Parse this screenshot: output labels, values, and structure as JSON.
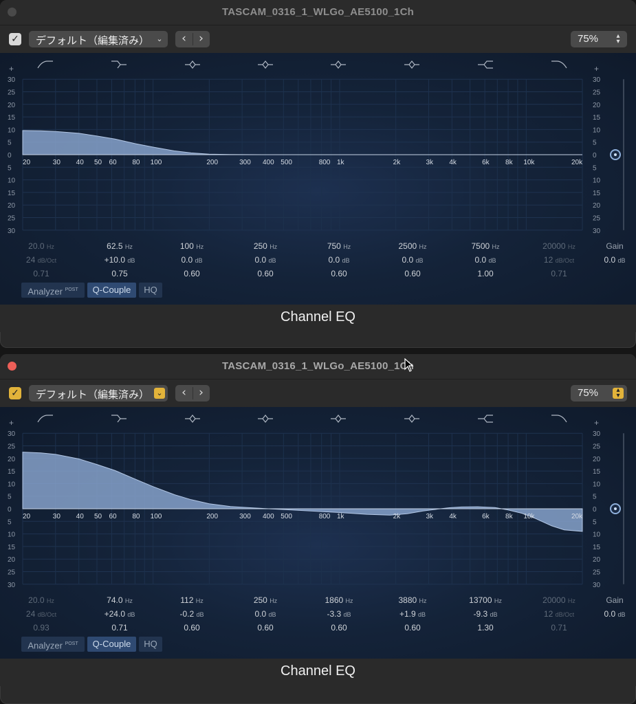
{
  "windows": [
    {
      "title": "TASCAM_0316_1_WLGo_AE5100_1Ch",
      "close_active": false,
      "preset": "デフォルト（編集済み）",
      "zoom": "75%",
      "footer": "Channel EQ",
      "bands": [
        {
          "freq": "20.0",
          "freq_unit": "Hz",
          "gain": "24",
          "gain_unit": "dB/Oct",
          "q": "0.71",
          "dim": true
        },
        {
          "freq": "62.5",
          "freq_unit": "Hz",
          "gain": "+10.0",
          "gain_unit": "dB",
          "q": "0.75",
          "dim": false
        },
        {
          "freq": "100",
          "freq_unit": "Hz",
          "gain": "0.0",
          "gain_unit": "dB",
          "q": "0.60",
          "dim": false
        },
        {
          "freq": "250",
          "freq_unit": "Hz",
          "gain": "0.0",
          "gain_unit": "dB",
          "q": "0.60",
          "dim": false
        },
        {
          "freq": "750",
          "freq_unit": "Hz",
          "gain": "0.0",
          "gain_unit": "dB",
          "q": "0.60",
          "dim": false
        },
        {
          "freq": "2500",
          "freq_unit": "Hz",
          "gain": "0.0",
          "gain_unit": "dB",
          "q": "0.60",
          "dim": false
        },
        {
          "freq": "7500",
          "freq_unit": "Hz",
          "gain": "0.0",
          "gain_unit": "dB",
          "q": "1.00",
          "dim": false
        },
        {
          "freq": "20000",
          "freq_unit": "Hz",
          "gain": "12",
          "gain_unit": "dB/Oct",
          "q": "0.71",
          "dim": true
        }
      ],
      "output_gain": {
        "label": "Gain",
        "value": "0.0",
        "unit": "dB"
      },
      "curve": [
        [
          20,
          9.6
        ],
        [
          25,
          9.5
        ],
        [
          30,
          9.2
        ],
        [
          40,
          8.5
        ],
        [
          50,
          7.4
        ],
        [
          62.5,
          6.2
        ],
        [
          80,
          4.4
        ],
        [
          100,
          3.0
        ],
        [
          130,
          1.5
        ],
        [
          160,
          0.7
        ],
        [
          200,
          0.2
        ],
        [
          260,
          0.05
        ],
        [
          400,
          0
        ],
        [
          20000,
          0
        ]
      ]
    },
    {
      "title": "TASCAM_0316_1_WLGo_AE5100_1Ch",
      "close_active": true,
      "preset": "デフォルト（編集済み）",
      "zoom": "75%",
      "footer": "Channel EQ",
      "bands": [
        {
          "freq": "20.0",
          "freq_unit": "Hz",
          "gain": "24",
          "gain_unit": "dB/Oct",
          "q": "0.93",
          "dim": true
        },
        {
          "freq": "74.0",
          "freq_unit": "Hz",
          "gain": "+24.0",
          "gain_unit": "dB",
          "q": "0.71",
          "dim": false
        },
        {
          "freq": "112",
          "freq_unit": "Hz",
          "gain": "-0.2",
          "gain_unit": "dB",
          "q": "0.60",
          "dim": false
        },
        {
          "freq": "250",
          "freq_unit": "Hz",
          "gain": "0.0",
          "gain_unit": "dB",
          "q": "0.60",
          "dim": false
        },
        {
          "freq": "1860",
          "freq_unit": "Hz",
          "gain": "-3.3",
          "gain_unit": "dB",
          "q": "0.60",
          "dim": false
        },
        {
          "freq": "3880",
          "freq_unit": "Hz",
          "gain": "+1.9",
          "gain_unit": "dB",
          "q": "0.60",
          "dim": false
        },
        {
          "freq": "13700",
          "freq_unit": "Hz",
          "gain": "-9.3",
          "gain_unit": "dB",
          "q": "1.30",
          "dim": false
        },
        {
          "freq": "20000",
          "freq_unit": "Hz",
          "gain": "12",
          "gain_unit": "dB/Oct",
          "q": "0.71",
          "dim": true
        }
      ],
      "output_gain": {
        "label": "Gain",
        "value": "0.0",
        "unit": "dB"
      },
      "curve": [
        [
          20,
          22.5
        ],
        [
          25,
          22.2
        ],
        [
          30,
          21.6
        ],
        [
          40,
          19.8
        ],
        [
          50,
          17.6
        ],
        [
          62.5,
          15.2
        ],
        [
          80,
          11.8
        ],
        [
          100,
          8.8
        ],
        [
          130,
          5.6
        ],
        [
          160,
          3.6
        ],
        [
          200,
          2.0
        ],
        [
          260,
          0.9
        ],
        [
          350,
          0.3
        ],
        [
          500,
          -0.3
        ],
        [
          700,
          -0.9
        ],
        [
          1000,
          -1.5
        ],
        [
          1400,
          -2.2
        ],
        [
          1860,
          -2.5
        ],
        [
          2300,
          -2.0
        ],
        [
          2800,
          -0.9
        ],
        [
          3300,
          -0.2
        ],
        [
          3880,
          0.4
        ],
        [
          4500,
          0.7
        ],
        [
          5500,
          0.8
        ],
        [
          6800,
          0.5
        ],
        [
          8000,
          -0.5
        ],
        [
          9500,
          -1.8
        ],
        [
          11000,
          -3.6
        ],
        [
          13700,
          -6.8
        ],
        [
          16000,
          -8.4
        ],
        [
          20000,
          -9.0
        ]
      ]
    }
  ],
  "scale_labels": [
    "30",
    "25",
    "20",
    "15",
    "10",
    "5",
    "0",
    "5",
    "10",
    "15",
    "20",
    "25",
    "30"
  ],
  "freq_ticks": [
    {
      "f": 20,
      "l": "20"
    },
    {
      "f": 30,
      "l": "30"
    },
    {
      "f": 40,
      "l": "40"
    },
    {
      "f": 50,
      "l": "50"
    },
    {
      "f": 60,
      "l": "60"
    },
    {
      "f": 80,
      "l": "80"
    },
    {
      "f": 100,
      "l": "100"
    },
    {
      "f": 200,
      "l": "200"
    },
    {
      "f": 300,
      "l": "300"
    },
    {
      "f": 400,
      "l": "400"
    },
    {
      "f": 500,
      "l": "500"
    },
    {
      "f": 800,
      "l": "800"
    },
    {
      "f": 1000,
      "l": "1k"
    },
    {
      "f": 2000,
      "l": "2k"
    },
    {
      "f": 3000,
      "l": "3k"
    },
    {
      "f": 4000,
      "l": "4k"
    },
    {
      "f": 6000,
      "l": "6k"
    },
    {
      "f": 8000,
      "l": "8k"
    },
    {
      "f": 10000,
      "l": "10k"
    },
    {
      "f": 20000,
      "l": "20k"
    }
  ],
  "buttons": {
    "analyzer": "Analyzer",
    "analyzer_sup": "POST",
    "qcouple": "Q-Couple",
    "hq": "HQ"
  },
  "plus_sign": "+",
  "band_icons": [
    "low-cut-icon",
    "low-shelf-icon",
    "bell-icon",
    "bell-icon",
    "bell-icon",
    "bell-icon",
    "high-shelf-icon",
    "high-cut-icon"
  ],
  "check_glyph": "✓"
}
